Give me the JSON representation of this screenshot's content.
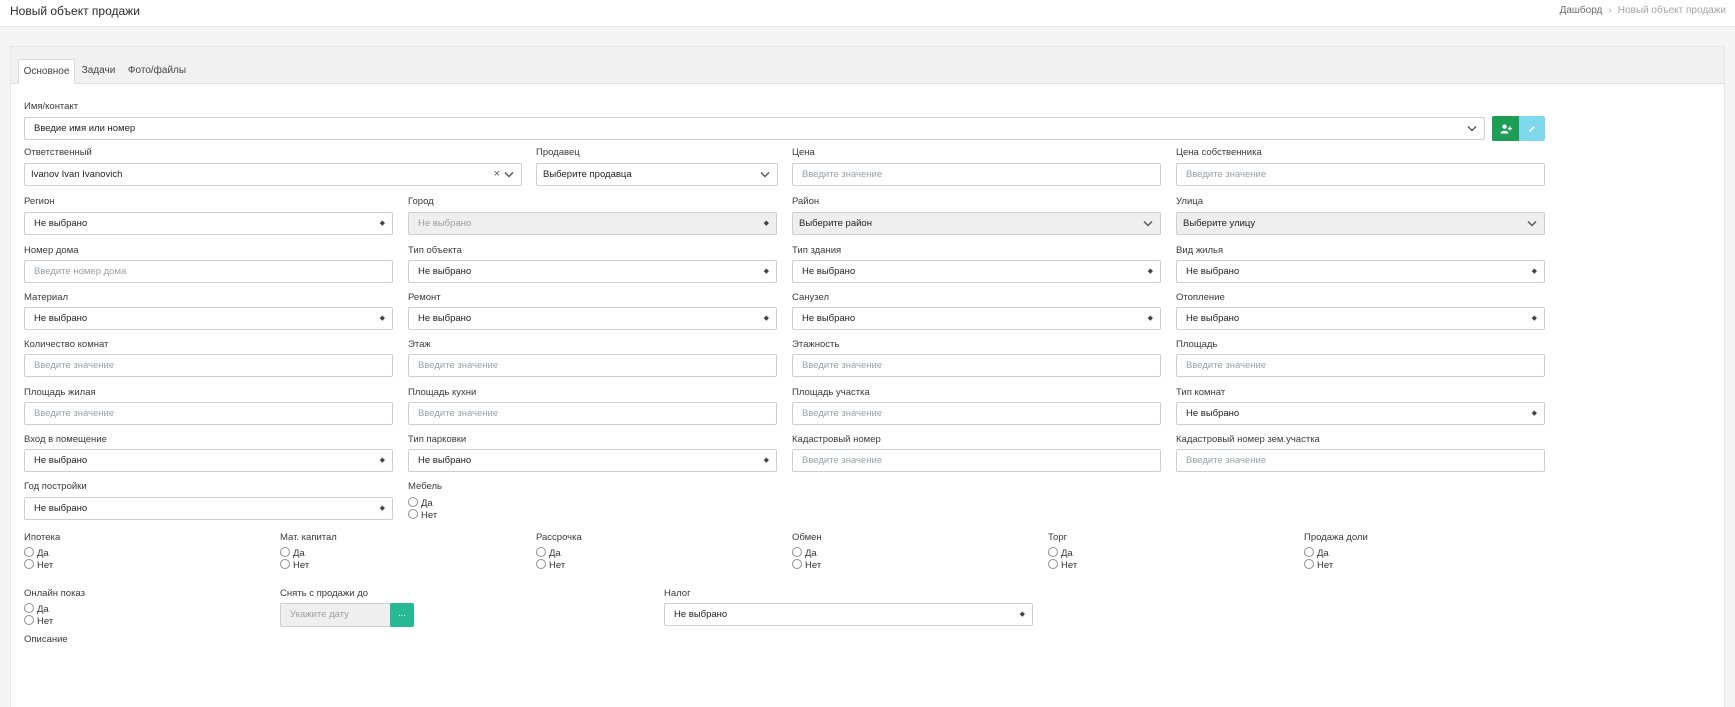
{
  "header": {
    "title": "Новый объект продажи",
    "breadcrumb": [
      "Дашборд",
      "Новый объект продажи"
    ]
  },
  "tabs": [
    "Основное",
    "Задачи",
    "Фото/файлы"
  ],
  "contact": {
    "label": "Имя/контакт",
    "placeholder": "Введие имя или номер"
  },
  "responsible": {
    "label": "Ответственный",
    "value": "Ivanov Ivan Ivanovich"
  },
  "seller": {
    "label": "Продавец",
    "value": "Выберите продавца"
  },
  "price": {
    "label": "Цена",
    "placeholder": "Введите значение"
  },
  "owner_price": {
    "label": "Цена собственника",
    "placeholder": "Введите значение"
  },
  "region": {
    "label": "Регион",
    "value": "Не выбрано"
  },
  "city": {
    "label": "Город",
    "value": "Не выбрано"
  },
  "district": {
    "label": "Район",
    "value": "Выберите район"
  },
  "street": {
    "label": "Улица",
    "value": "Выберите улицу"
  },
  "house": {
    "label": "Номер дома",
    "placeholder": "Введите номер дома"
  },
  "object_type": {
    "label": "Тип объекта",
    "value": "Не выбрано"
  },
  "building_type": {
    "label": "Тип здания",
    "value": "Не выбрано"
  },
  "housing_type": {
    "label": "Вид жилья",
    "value": "Не выбрано"
  },
  "material": {
    "label": "Материал",
    "value": "Не выбрано"
  },
  "repair": {
    "label": "Ремонт",
    "value": "Не выбрано"
  },
  "bathroom": {
    "label": "Санузел",
    "value": "Не выбрано"
  },
  "heating": {
    "label": "Отопление",
    "value": "Не выбрано"
  },
  "rooms": {
    "label": "Количество комнат",
    "placeholder": "Введите значение"
  },
  "floor": {
    "label": "Этаж",
    "placeholder": "Введите значение"
  },
  "floors": {
    "label": "Этажность",
    "placeholder": "Введите значение"
  },
  "area": {
    "label": "Площадь",
    "placeholder": "Введите значение"
  },
  "living_area": {
    "label": "Площадь жилая",
    "placeholder": "Введите значение"
  },
  "kitchen_area": {
    "label": "Площадь кухни",
    "placeholder": "Введите значение"
  },
  "plot_area": {
    "label": "Площадь участка",
    "placeholder": "Введите значение"
  },
  "room_type": {
    "label": "Тип комнат",
    "value": "Не выбрано"
  },
  "entrance": {
    "label": "Вход в помещение",
    "value": "Не выбрано"
  },
  "parking": {
    "label": "Тип парковки",
    "value": "Не выбрано"
  },
  "cadastral": {
    "label": "Кадастровый номер",
    "placeholder": "Введите значение"
  },
  "cadastral_land": {
    "label": "Кадастровый номер зем.участка",
    "placeholder": "Введите значение"
  },
  "year": {
    "label": "Год постройки",
    "value": "Не выбрано"
  },
  "yes": "Да",
  "no": "Нет",
  "furniture": {
    "label": "Мебель"
  },
  "mortgage": {
    "label": "Ипотека"
  },
  "mat_capital": {
    "label": "Мат. капитал"
  },
  "installment": {
    "label": "Рассрочка"
  },
  "exchange": {
    "label": "Обмен"
  },
  "bargain": {
    "label": "Торг"
  },
  "share_sale": {
    "label": "Продажа доли"
  },
  "online_show": {
    "label": "Онлайн показ"
  },
  "remove_until": {
    "label": "Снять с продажи до",
    "placeholder": "Укажите дату",
    "button": "..."
  },
  "tax": {
    "label": "Налог",
    "value": "Не выбрано"
  },
  "description": {
    "label": "Описание"
  },
  "colors": {
    "green": "#1e9e55",
    "teal": "#26b994",
    "light_blue": "#7fd9ee"
  }
}
